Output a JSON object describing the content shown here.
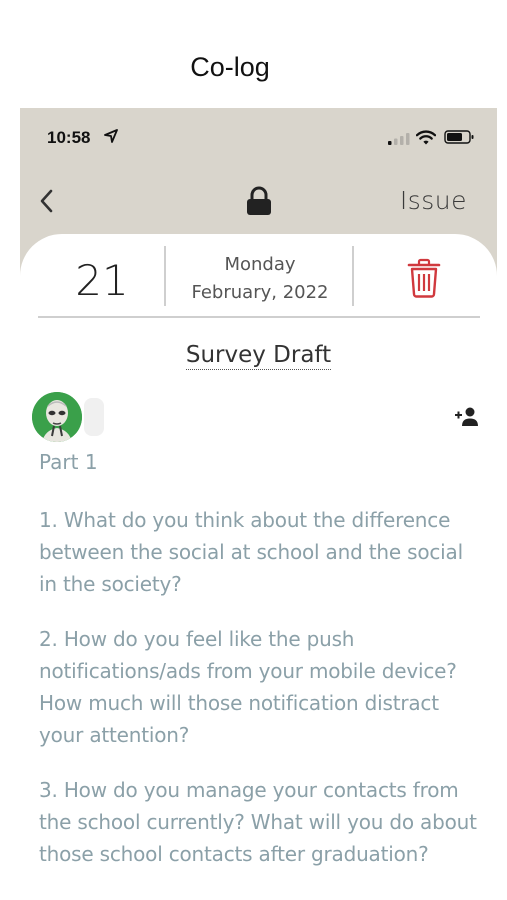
{
  "header": {
    "title": "Co-log"
  },
  "status_bar": {
    "time": "10:58",
    "icons": [
      "location-arrow-icon",
      "signal-icon",
      "wifi-icon",
      "battery-icon"
    ]
  },
  "nav": {
    "back_icon": "chevron-left-icon",
    "center_icon": "lock-icon",
    "issue_label": "Issue"
  },
  "date": {
    "day": "21",
    "weekday": "Monday",
    "month_year": "February, 2022",
    "delete_icon": "trash-icon"
  },
  "document": {
    "title": "Survey Draft",
    "add_member_icon": "add-person-icon",
    "section": "Part 1",
    "questions": [
      "1. What do you think about the difference between the social at school and the social in the society?",
      "2. How do you feel like the push notifications/ads from your mobile device? How much will those notification distract your attention?",
      "3. How do you manage your contacts from the school currently? What will you do about those school contacts after graduation?"
    ]
  },
  "colors": {
    "app_bg": "#d9d5cc",
    "question_text": "#8ba0a8",
    "trash": "#d0393e",
    "avatar_bg": "#3aa04a"
  }
}
